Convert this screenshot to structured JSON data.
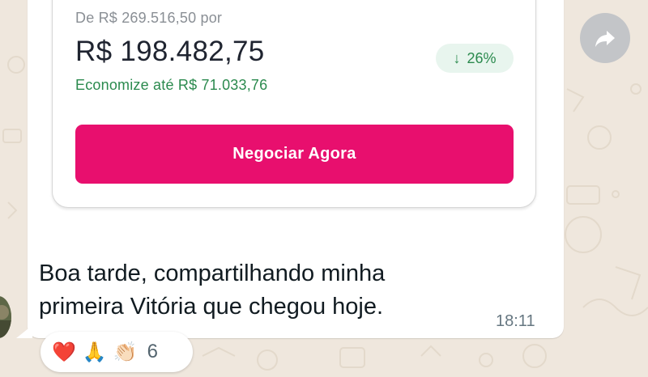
{
  "card": {
    "original_price": "De R$ 269.516,50 por",
    "current_price": "R$ 198.482,75",
    "savings": "Economize até R$ 71.033,76",
    "discount_arrow": "↓",
    "discount": "26%",
    "cta_label": "Negociar Agora"
  },
  "message": {
    "text": "Boa tarde, compartilhando minha\nprimeira Vitória que chegou hoje.",
    "time": "18:11"
  },
  "reactions": {
    "emojis": [
      "❤️",
      "🙏",
      "👏🏻"
    ],
    "count": "6"
  },
  "icons": {
    "forward": "forward-icon",
    "avatar": "avatar"
  },
  "colors": {
    "accent": "#e80f6e",
    "savings_green": "#2b8a4e",
    "chat_background": "#efe7dd"
  }
}
